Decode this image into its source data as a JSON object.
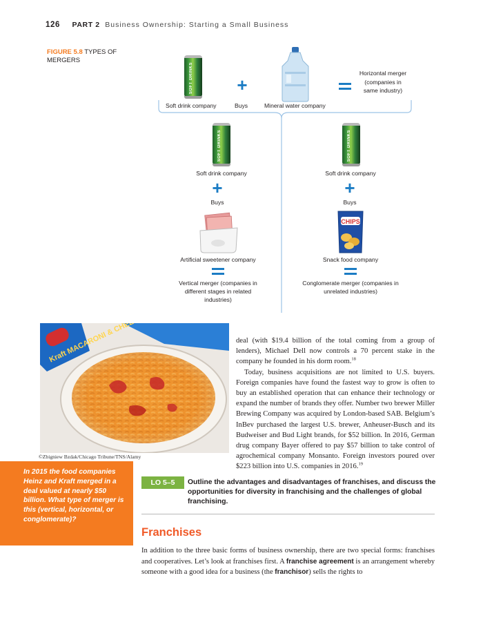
{
  "header": {
    "page_number": "126",
    "part_label": "PART 2",
    "part_title": "Business Ownership: Starting a Small Business"
  },
  "figure": {
    "number": "FIGURE 5.8",
    "title": "TYPES OF MERGERS",
    "can_text": "SOFT DRINKS",
    "chips_text": "CHIPS",
    "top_row": {
      "left_label": "Soft drink company",
      "buys_label": "Buys",
      "right_label": "Mineral water company",
      "result_label": "Horizontal merger (companies in same industry)"
    },
    "vertical": {
      "company_label": "Soft drink company",
      "buys_label": "Buys",
      "target_label": "Artificial sweetener company",
      "result_label": "Vertical merger (companies in different stages in related industries)"
    },
    "conglomerate": {
      "company_label": "Soft drink company",
      "buys_label": "Buys",
      "target_label": "Snack food company",
      "result_label": "Conglomerate merger (companies in unrelated industries)"
    }
  },
  "photo": {
    "credit": "©Zbigniew Bzdak/Chicago Tribune/TNS/Alamy",
    "box_text": "Kraft MACARONI & CHEESE"
  },
  "callout": {
    "text": "In 2015 the food companies Heinz and Kraft merged in a deal valued at nearly $50 billion. What type of merger is this (vertical, horizontal, or conglomerate)?"
  },
  "column": {
    "para1": "deal (with $19.4 billion of the total coming from a group of lenders), Michael Dell now controls a 70 percent stake in the company he founded in his dorm room.",
    "para1_note": "18",
    "para2": "Today, business acquisitions are not limited to U.S. buyers. Foreign companies have found the fastest way to grow is often to buy an established operation that can enhance their technology or expand the number of brands they offer. Number two brewer Miller Brewing Company was acquired by London-based SAB. Belgium’s InBev purchased the largest U.S. brewer, Anheuser-Busch and its Budweiser and Bud Light brands, for $52 billion. In 2016, German drug company Bayer offered to pay $57 billion to take control of agrochemical company Monsanto. Foreign investors poured over $223 billion into U.S. companies in 2016.",
    "para2_note": "19"
  },
  "learning_objective": {
    "badge": "LO 5–5",
    "text": "Outline the advantages and disadvantages of franchises, and discuss the opportunities for diversity in franchising and the challenges of global franchising."
  },
  "section": {
    "title": "Franchises",
    "text_before": "In addition to the three basic forms of business ownership, there are two special forms: franchises and cooperatives. Let’s look at franchises first. A ",
    "term1": "franchise agreement",
    "text_middle": " is an arrangement whereby someone with a good idea for a business (the ",
    "term2": "franchisor",
    "text_after": ") sells the rights to"
  },
  "colors": {
    "accent_orange": "#f47b20",
    "title_red_orange": "#f05a28",
    "diagram_blue": "#1b7cc4",
    "lo_green": "#7cb342"
  }
}
